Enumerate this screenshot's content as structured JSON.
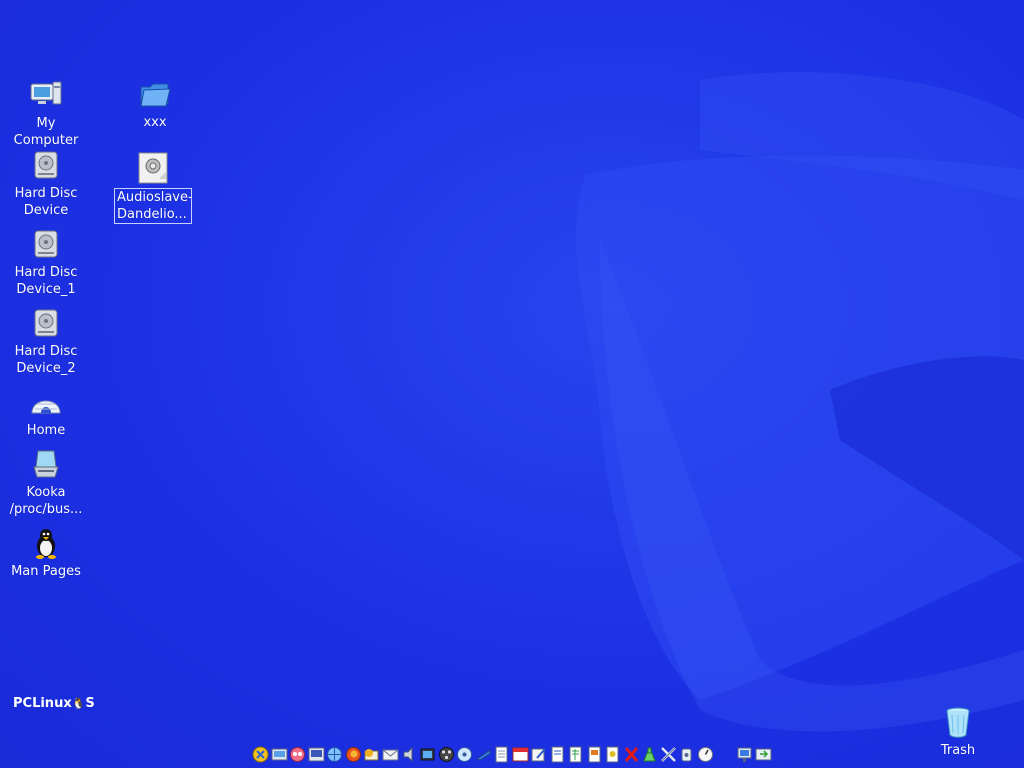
{
  "desktop": {
    "icons": [
      {
        "id": "my-computer",
        "label": "My\nComputer"
      },
      {
        "id": "hard-disc-device",
        "label": "Hard Disc\nDevice"
      },
      {
        "id": "hard-disc-device-1",
        "label": "Hard Disc\nDevice_1"
      },
      {
        "id": "hard-disc-device-2",
        "label": "Hard Disc\nDevice_2"
      },
      {
        "id": "home",
        "label": "Home"
      },
      {
        "id": "kooka",
        "label": "Kooka\n/proc/bus..."
      },
      {
        "id": "man-pages",
        "label": "Man Pages"
      },
      {
        "id": "xxx-folder",
        "label": "xxx"
      },
      {
        "id": "audioslave-file",
        "label": "Audioslave-\nDandelio..."
      },
      {
        "id": "trash",
        "label": "Trash"
      }
    ],
    "brand": {
      "text_left": "PCLinux",
      "text_right": "S"
    }
  },
  "taskbar": {
    "icons": [
      "kde-menu-icon",
      "show-desktop-icon",
      "eye-icon",
      "terminal-icon",
      "konqueror-icon",
      "firefox-icon",
      "thunderbird-icon",
      "kmail-icon",
      "speaker-icon",
      "video-icon",
      "film-reel-icon",
      "cd-player-icon",
      "k3b-icon",
      "document-icon",
      "calendar-icon",
      "edit-icon",
      "writer-icon",
      "calc-icon",
      "impress-icon",
      "draw-icon",
      "x-close-icon",
      "package-icon",
      "tools-icon",
      "info-icon",
      "clock-icon",
      "network-icon",
      "pager-icon"
    ]
  },
  "colors": {
    "desktop_bg": "#1f33e6",
    "label_text": "#ffffff"
  }
}
